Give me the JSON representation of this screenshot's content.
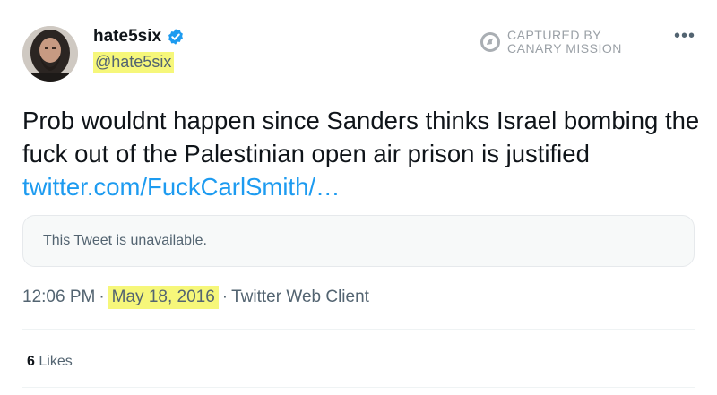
{
  "author": {
    "display_name": "hate5six",
    "handle": "@hate5six",
    "verified": true
  },
  "watermark": {
    "line1": "CAPTURED BY",
    "line2": "CANARY MISSION"
  },
  "tweet": {
    "text": "Prob wouldnt happen since Sanders thinks Israel bombing the fuck out of the Palestinian open air prison is justified ",
    "link": "twitter.com/FuckCarlSmith/…"
  },
  "quoted_tweet": {
    "text": "This Tweet is unavailable."
  },
  "meta": {
    "time": "12:06 PM",
    "separator": "·",
    "date": "May 18, 2016",
    "client": "Twitter Web Client"
  },
  "stats": {
    "likes_count": "6",
    "likes_label": "Likes"
  },
  "icons": {
    "more": "more-horizontal-icon",
    "verified": "verified-badge-icon",
    "watermark": "canary-mission-logo-icon"
  },
  "colors": {
    "link": "#1d9bf0",
    "verified": "#1d9bf0",
    "highlight": "#f6f77a",
    "secondary_text": "#536471"
  }
}
